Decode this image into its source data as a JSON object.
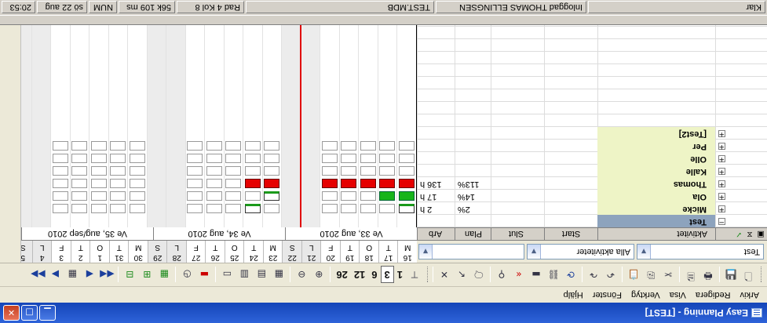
{
  "window": {
    "title": "Easy Planning - [TEST]"
  },
  "menu": [
    "Arkiv",
    "Redigera",
    "Visa",
    "Verktyg",
    "Fönster",
    "Hjälp"
  ],
  "toolbar": {
    "zoom_levels": [
      "1",
      "3",
      "6",
      "12",
      "26"
    ],
    "active_zoom": "3"
  },
  "filters": {
    "resource": "Test",
    "activity": "Alla aktiviteter",
    "third": ""
  },
  "columns": {
    "activity": "Aktivitet",
    "start": "Start",
    "end": "Slut",
    "plan": "Plan",
    "arb": "Arb"
  },
  "weeks": [
    {
      "label": "Ve 33, aug 2010",
      "days": [
        "16",
        "17",
        "18",
        "19",
        "20",
        "21",
        "22"
      ]
    },
    {
      "label": "Ve 34, aug 2010",
      "days": [
        "23",
        "24",
        "25",
        "26",
        "27",
        "28",
        "29"
      ]
    },
    {
      "label": "Ve 35, aug/sep 2010",
      "days": [
        "30",
        "31",
        "1",
        "2",
        "3",
        "4",
        "5"
      ]
    }
  ],
  "weekdays": [
    "M",
    "T",
    "O",
    "T",
    "F",
    "L",
    "S"
  ],
  "rows": [
    {
      "name": "Test",
      "plan": "",
      "arb": "",
      "expand": "−",
      "selected": true
    },
    {
      "name": "Micke",
      "plan": "2%",
      "arb": "2 h",
      "expand": "+"
    },
    {
      "name": "Ola",
      "plan": "14%",
      "arb": "17 h",
      "expand": "+"
    },
    {
      "name": "Thomas",
      "plan": "113%",
      "arb": "136 h",
      "expand": "+"
    },
    {
      "name": "Kalle",
      "plan": "",
      "arb": "",
      "expand": "+"
    },
    {
      "name": "Olle",
      "plan": "",
      "arb": "",
      "expand": "+"
    },
    {
      "name": "Per",
      "plan": "",
      "arb": "",
      "expand": "+"
    },
    {
      "name": "[Test2]",
      "plan": "",
      "arb": "",
      "expand": "+"
    }
  ],
  "status": {
    "ready": "Klar",
    "user": "Inloggad THOMAS ELLINGSEN",
    "db": "TEST.MDB",
    "pos": "Rad 4 Kol 8",
    "time": "56k 109 ms",
    "num": "NUM",
    "date": "sö 22 aug",
    "clock": "20:53"
  }
}
